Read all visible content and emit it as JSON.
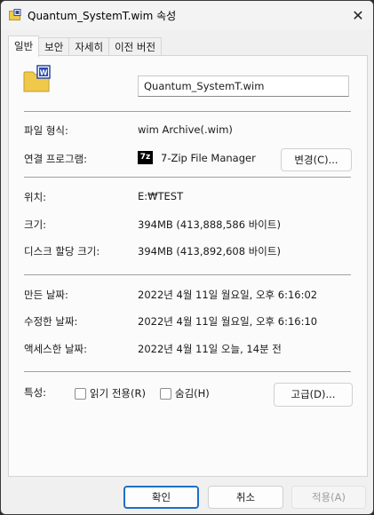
{
  "window": {
    "title": "Quantum_SystemT.wim 속성",
    "close_glyph": "✕"
  },
  "tabs": [
    "일반",
    "보안",
    "자세히",
    "이전 버전"
  ],
  "general": {
    "file_name": "Quantum_SystemT.wim",
    "file_type_label": "파일 형식:",
    "file_type_value": "wim Archive(.wim)",
    "opens_with_label": "연결 프로그램:",
    "opens_with_value": "7-Zip File Manager",
    "opens_with_icon_text": "7z",
    "change_button": "변경(C)...",
    "location_label": "위치:",
    "location_value": "E:₩TEST",
    "size_label": "크기:",
    "size_value": "394MB (413,888,586 바이트)",
    "size_on_disk_label": "디스크 할당 크기:",
    "size_on_disk_value": "394MB (413,892,608 바이트)",
    "created_label": "만든 날짜:",
    "created_value": "2022년 4월 11일 월요일, 오후 6:16:02",
    "modified_label": "수정한 날짜:",
    "modified_value": "2022년 4월 11일 월요일, 오후 6:16:10",
    "accessed_label": "액세스한 날짜:",
    "accessed_value": "2022년 4월 11일 오늘, 14분 전",
    "attributes_label": "특성:",
    "readonly_label": "읽기 전용(R)",
    "hidden_label": "숨김(H)",
    "advanced_button": "고급(D)..."
  },
  "footer": {
    "ok": "확인",
    "cancel": "취소",
    "apply": "적용(A)"
  },
  "colors": {
    "accent": "#1f6fc4",
    "folder": "#f0c94a",
    "sevenzip": "#000000"
  }
}
